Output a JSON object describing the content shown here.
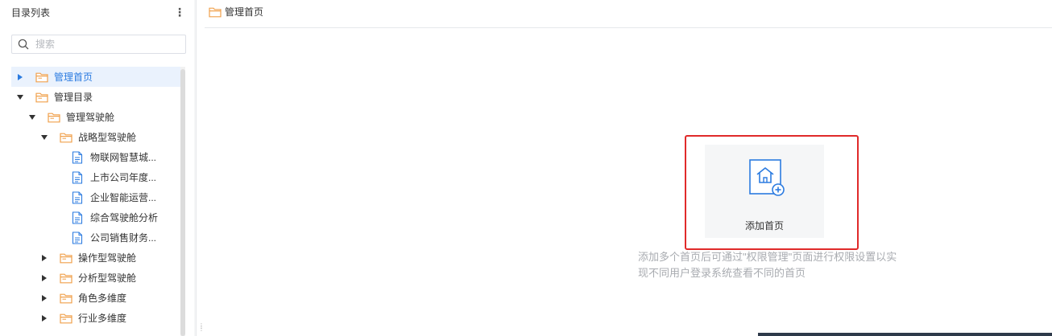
{
  "sidebar": {
    "title": "目录列表",
    "more_label": "⋮",
    "search": {
      "placeholder": "搜索",
      "value": ""
    },
    "tree": [
      {
        "label": "管理首页",
        "depth": 0,
        "toggle": "right",
        "icon": "folder-icon",
        "selected": true
      },
      {
        "label": "管理目录",
        "depth": 0,
        "toggle": "down",
        "icon": "folder-icon"
      },
      {
        "label": "管理驾驶舱",
        "depth": 1,
        "toggle": "down",
        "icon": "folder-icon"
      },
      {
        "label": "战略型驾驶舱",
        "depth": 2,
        "toggle": "down",
        "icon": "folder-icon"
      },
      {
        "label": "物联网智慧城...",
        "depth": 3,
        "toggle": "none",
        "icon": "document-icon"
      },
      {
        "label": "上市公司年度...",
        "depth": 3,
        "toggle": "none",
        "icon": "document-icon"
      },
      {
        "label": "企业智能运营...",
        "depth": 3,
        "toggle": "none",
        "icon": "document-icon"
      },
      {
        "label": "综合驾驶舱分析",
        "depth": 3,
        "toggle": "none",
        "icon": "document-icon"
      },
      {
        "label": "公司销售财务...",
        "depth": 3,
        "toggle": "none",
        "icon": "document-icon"
      },
      {
        "label": "操作型驾驶舱",
        "depth": 2,
        "toggle": "right",
        "icon": "folder-icon"
      },
      {
        "label": "分析型驾驶舱",
        "depth": 2,
        "toggle": "right",
        "icon": "folder-icon"
      },
      {
        "label": "角色多维度",
        "depth": 2,
        "toggle": "right",
        "icon": "folder-icon"
      },
      {
        "label": "行业多维度",
        "depth": 2,
        "toggle": "right",
        "icon": "folder-icon"
      }
    ]
  },
  "main": {
    "breadcrumb": "管理首页",
    "add_card": {
      "label": "添加首页"
    },
    "hint": "添加多个首页后可通过\"权限管理\"页面进行权限设置以实现不同用户登录系统查看不同的首页"
  },
  "colors": {
    "accent": "#2b7be0",
    "folder": "#f0a04b",
    "highlight": "#e02a2a",
    "selected_bg": "#eaf2fd"
  }
}
